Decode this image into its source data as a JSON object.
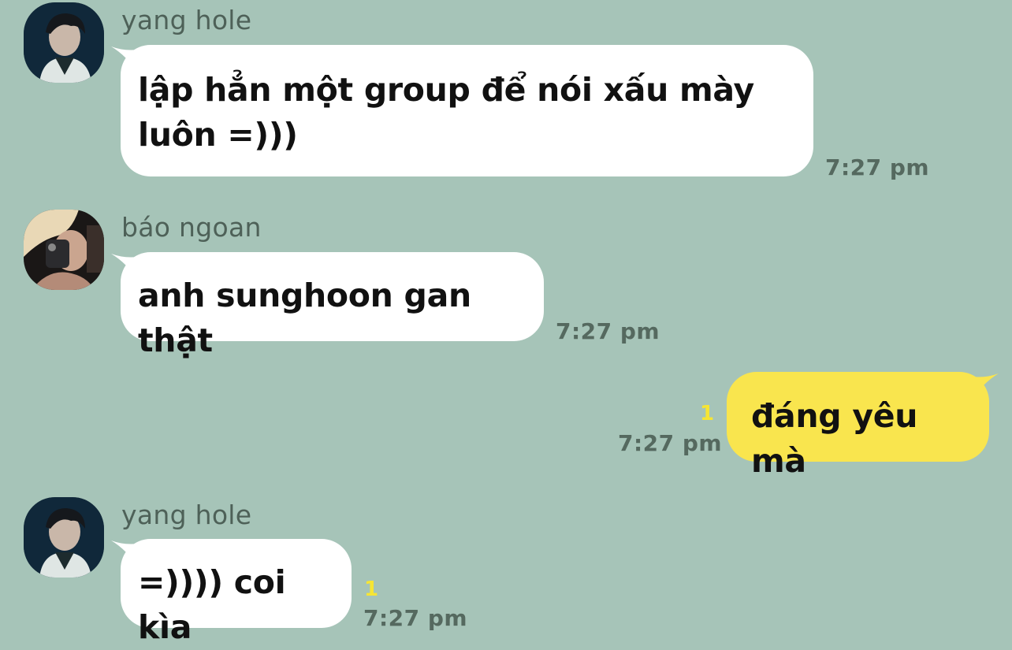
{
  "messages": [
    {
      "sender": "yang hole",
      "text": "lập hẳn một group để nói xấu mày luôn =)))",
      "time": "7:27 pm",
      "unread": ""
    },
    {
      "sender": "báo ngoan",
      "text": "anh sunghoon gan thật",
      "time": "7:27 pm",
      "unread": ""
    },
    {
      "sender": "",
      "text": "đáng yêu mà",
      "time": "7:27 pm",
      "unread": "1"
    },
    {
      "sender": "yang hole",
      "text": "=)))) coi kìa",
      "time": "7:27 pm",
      "unread": "1"
    }
  ],
  "colors": {
    "background": "#a6c4b8",
    "incoming_bubble": "#ffffff",
    "outgoing_bubble": "#f9e54e",
    "unread_badge": "#f6e534"
  }
}
